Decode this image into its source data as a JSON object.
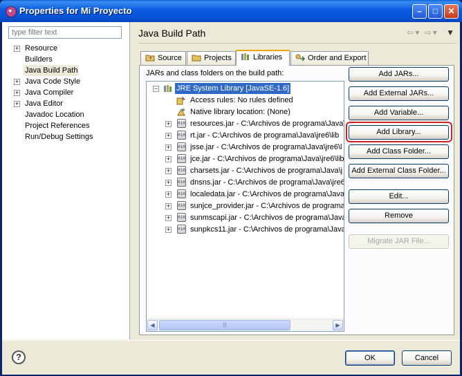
{
  "window": {
    "title": "Properties for Mi Proyecto"
  },
  "filter": {
    "placeholder": "type filter text"
  },
  "nav": [
    {
      "label": "Resource",
      "expandable": true
    },
    {
      "label": "Builders",
      "expandable": false
    },
    {
      "label": "Java Build Path",
      "expandable": false,
      "selected": true
    },
    {
      "label": "Java Code Style",
      "expandable": true
    },
    {
      "label": "Java Compiler",
      "expandable": true
    },
    {
      "label": "Java Editor",
      "expandable": true
    },
    {
      "label": "Javadoc Location",
      "expandable": false
    },
    {
      "label": "Project References",
      "expandable": false
    },
    {
      "label": "Run/Debug Settings",
      "expandable": false
    }
  ],
  "page": {
    "title": "Java Build Path"
  },
  "tabs": [
    {
      "label": "Source",
      "icon": "source-folder-icon"
    },
    {
      "label": "Projects",
      "icon": "projects-icon"
    },
    {
      "label": "Libraries",
      "icon": "libraries-icon",
      "active": true
    },
    {
      "label": "Order and Export",
      "icon": "order-export-icon"
    }
  ],
  "libraries": {
    "intro": "JARs and class folders on the build path:",
    "tree": {
      "root": "JRE System Library [JavaSE-1.6]",
      "attributes": [
        {
          "label": "Access rules: No rules defined",
          "icon": "access-rules-icon"
        },
        {
          "label": "Native library location: (None)",
          "icon": "native-library-icon"
        }
      ],
      "jars": [
        "resources.jar - C:\\Archivos de programa\\Java\\",
        "rt.jar - C:\\Archivos de programa\\Java\\jre6\\lib",
        "jsse.jar - C:\\Archivos de programa\\Java\\jre6\\l",
        "jce.jar - C:\\Archivos de programa\\Java\\jre6\\lib",
        "charsets.jar - C:\\Archivos de programa\\Java\\j",
        "dnsns.jar - C:\\Archivos de programa\\Java\\jre6",
        "localedata.jar - C:\\Archivos de programa\\Java",
        "sunjce_provider.jar - C:\\Archivos de programa",
        "sunmscapi.jar - C:\\Archivos de programa\\Java",
        "sunpkcs11.jar - C:\\Archivos de programa\\Java"
      ],
      "jar_icon_text": "010"
    },
    "buttons": {
      "add_jars": "Add JARs...",
      "add_external_jars": "Add External JARs...",
      "add_variable": "Add Variable...",
      "add_library": "Add Library...",
      "add_class_folder": "Add Class Folder...",
      "add_external_class_folder": "Add External Class Folder...",
      "edit": "Edit...",
      "remove": "Remove",
      "migrate_jar": "Migrate JAR File..."
    }
  },
  "footer": {
    "help": "?",
    "ok": "OK",
    "cancel": "Cancel"
  },
  "colors": {
    "highlight": "#cc2222",
    "selection": "#316ac5",
    "titlebar": "#0a5be0"
  }
}
